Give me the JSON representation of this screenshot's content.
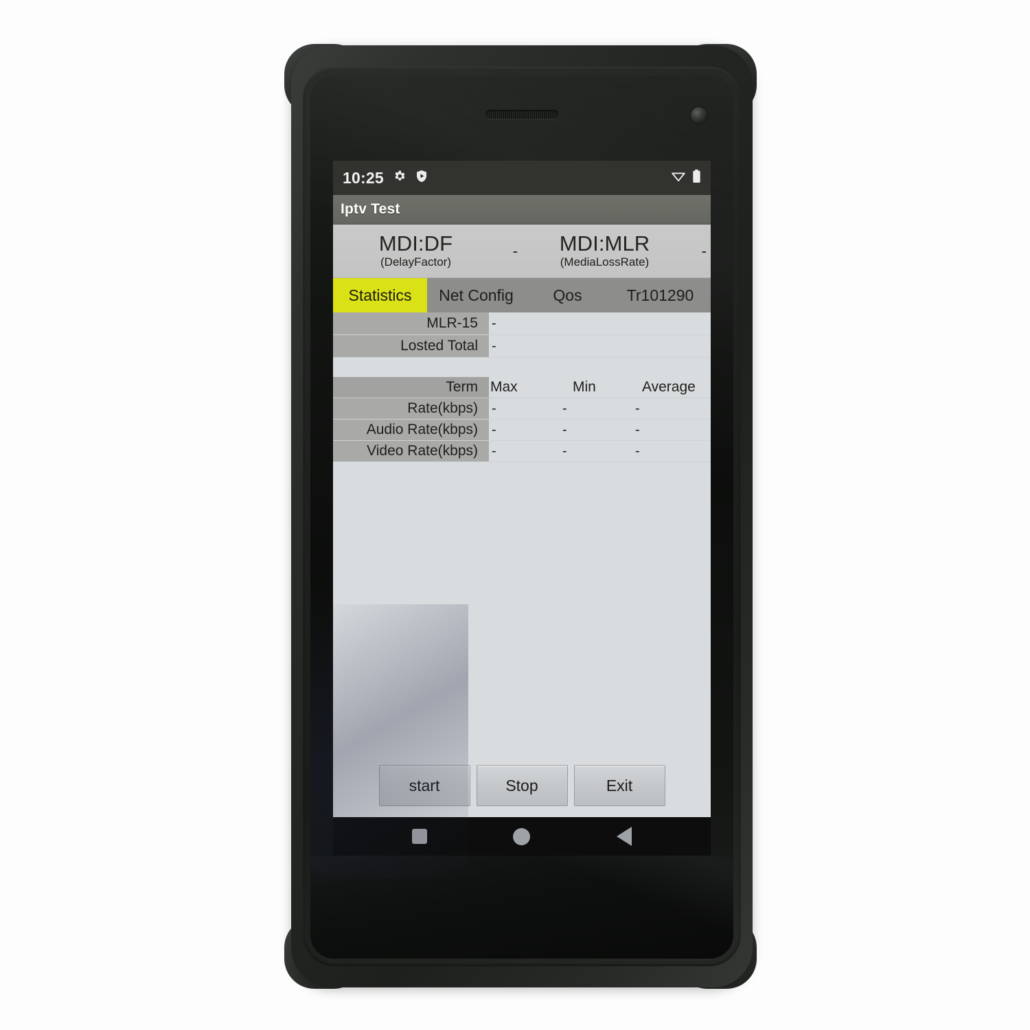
{
  "device": {
    "label": "rugged-android-handheld",
    "earpiece_icon": "speaker-grille-icon",
    "camera_icon": "front-camera-icon"
  },
  "status_bar": {
    "clock": "10:25",
    "left_icons": [
      {
        "name": "gear-icon",
        "label": "Settings"
      },
      {
        "name": "play-protect-shield-icon",
        "label": "Play Protect"
      }
    ],
    "right_icons": [
      {
        "name": "wifi-icon",
        "label": "Wi-Fi"
      },
      {
        "name": "battery-icon",
        "label": "Battery"
      }
    ]
  },
  "app": {
    "title": "Iptv Test"
  },
  "mdi": {
    "df": {
      "name": "MDI:DF",
      "sub": "(DelayFactor)",
      "value": "-"
    },
    "mlr": {
      "name": "MDI:MLR",
      "sub": "(MediaLossRate)",
      "value": "-"
    }
  },
  "tabs": [
    {
      "label": "Statistics",
      "active": true
    },
    {
      "label": "Net Config",
      "active": false
    },
    {
      "label": "Qos",
      "active": false
    },
    {
      "label": "Tr101290",
      "active": false
    }
  ],
  "summary_rows": [
    {
      "label": "MLR-15",
      "value": "-"
    },
    {
      "label": "Losted Total",
      "value": "-"
    }
  ],
  "rate_table": {
    "headers": [
      "Term",
      "Max",
      "Min",
      "Average"
    ],
    "rows": [
      {
        "term": "Rate(kbps)",
        "max": "-",
        "min": "-",
        "average": "-"
      },
      {
        "term": "Audio Rate(kbps)",
        "max": "-",
        "min": "-",
        "average": "-"
      },
      {
        "term": "Video Rate(kbps)",
        "max": "-",
        "min": "-",
        "average": "-"
      }
    ]
  },
  "buttons": [
    {
      "label": "start",
      "name": "start-button"
    },
    {
      "label": "Stop",
      "name": "stop-button"
    },
    {
      "label": "Exit",
      "name": "exit-button"
    }
  ],
  "nav_bar": [
    {
      "name": "recents-button",
      "icon": "square-icon"
    },
    {
      "name": "home-button",
      "icon": "circle-icon"
    },
    {
      "name": "back-button",
      "icon": "triangle-left-icon"
    }
  ],
  "colors": {
    "accent_tab": "#dbe117",
    "action_bar": "#64665f",
    "status_bar": "#32332f",
    "table_label": "#a9aaa8",
    "content_bg": "#d9dcdf",
    "tab_bar": "#8d8e8b"
  }
}
